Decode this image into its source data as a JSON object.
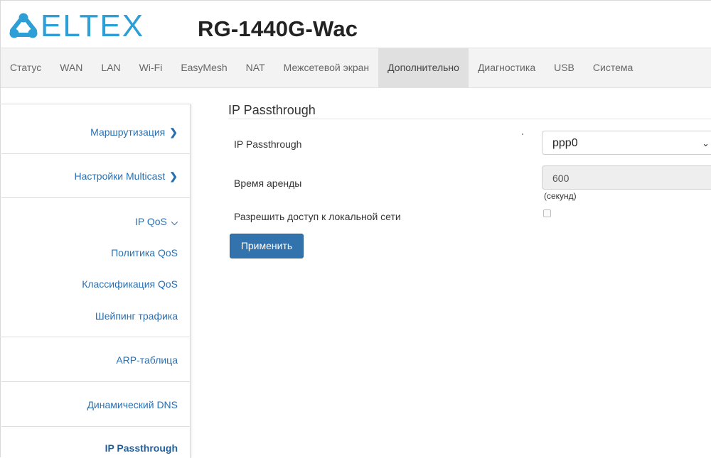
{
  "header": {
    "brand": "ELTEX",
    "model": "RG-1440G-Wac",
    "brand_color": "#2e9fd6"
  },
  "nav": {
    "items": [
      {
        "label": "Статус",
        "active": false
      },
      {
        "label": "WAN",
        "active": false
      },
      {
        "label": "LAN",
        "active": false
      },
      {
        "label": "Wi-Fi",
        "active": false
      },
      {
        "label": "EasyMesh",
        "active": false
      },
      {
        "label": "NAT",
        "active": false
      },
      {
        "label": "Межсетевой экран",
        "active": false
      },
      {
        "label": "Дополнительно",
        "active": true
      },
      {
        "label": "Диагностика",
        "active": false
      },
      {
        "label": "USB",
        "active": false
      },
      {
        "label": "Система",
        "active": false
      }
    ]
  },
  "sidebar": {
    "routing": "Маршрутизация",
    "multicast": "Настройки Multicast",
    "ipqos": "IP QoS",
    "qos_policy": "Политика QoS",
    "qos_class": "Классификация QoS",
    "shaping": "Шейпинг трафика",
    "arp": "ARP-таблица",
    "ddns": "Динамический DNS",
    "passthrough": "IP Passthrough"
  },
  "form": {
    "title": "IP Passthrough",
    "passthrough_label": "IP Passthrough",
    "passthrough_value": "ppp0",
    "lease_label": "Время аренды",
    "lease_value": "600",
    "lease_unit": "(секунд)",
    "lan_access_label": "Разрешить доступ к локальной сети",
    "lan_access_checked": false,
    "apply_label": "Применить"
  },
  "colors": {
    "accent": "#3273ad",
    "link": "#2b6fb0",
    "nav_bg": "#f3f3f3",
    "nav_active_bg": "#e0e0e0"
  }
}
